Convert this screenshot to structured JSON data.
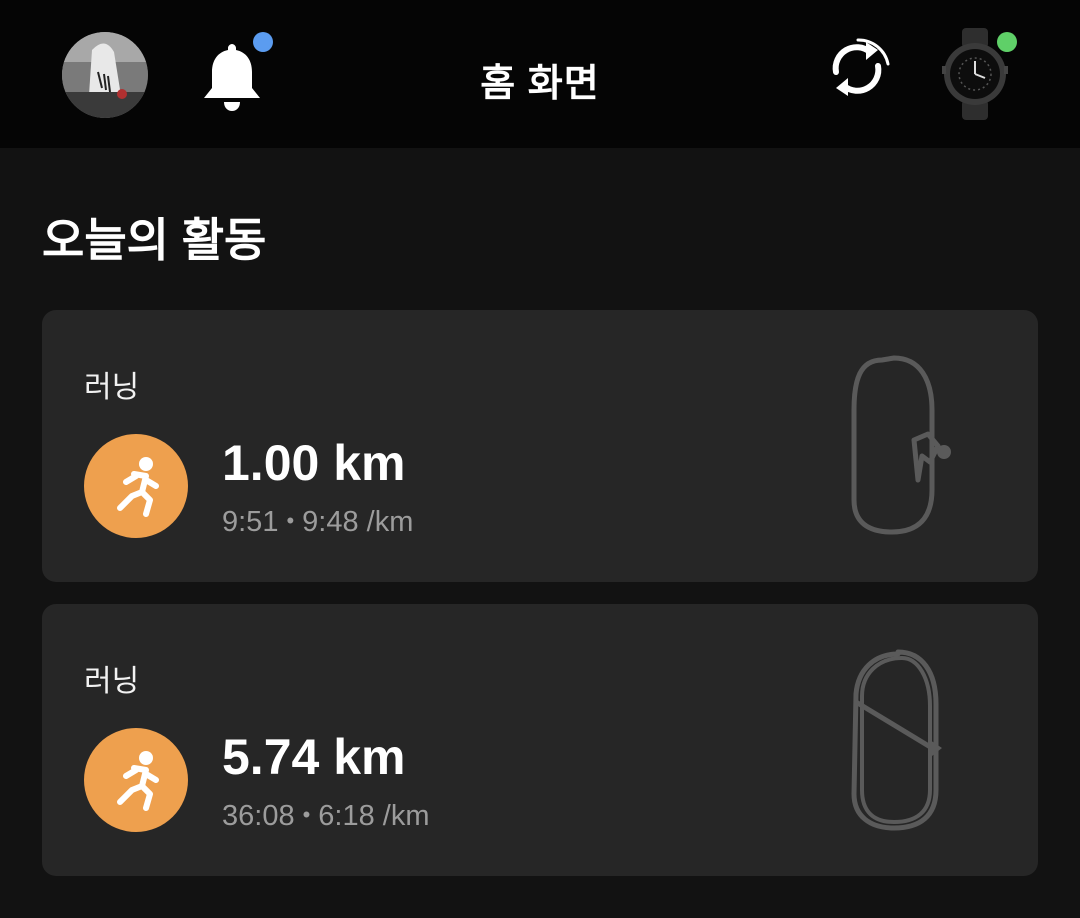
{
  "header": {
    "title": "홈 화면",
    "notification_dot_color": "#5b9cf0",
    "watch_dot_color": "#5fd068",
    "icons": [
      "avatar",
      "bell-icon",
      "sync-icon",
      "watch-icon"
    ]
  },
  "section": {
    "title": "오늘의 활동"
  },
  "activities": [
    {
      "type": "러닝",
      "distance": "1.00 km",
      "duration": "9:51",
      "separator": "•",
      "pace": "9:48 /km",
      "icon": "running-icon",
      "icon_color": "#eea04e"
    },
    {
      "type": "러닝",
      "distance": "5.74 km",
      "duration": "36:08",
      "separator": "•",
      "pace": "6:18 /km",
      "icon": "running-icon",
      "icon_color": "#eea04e"
    }
  ]
}
